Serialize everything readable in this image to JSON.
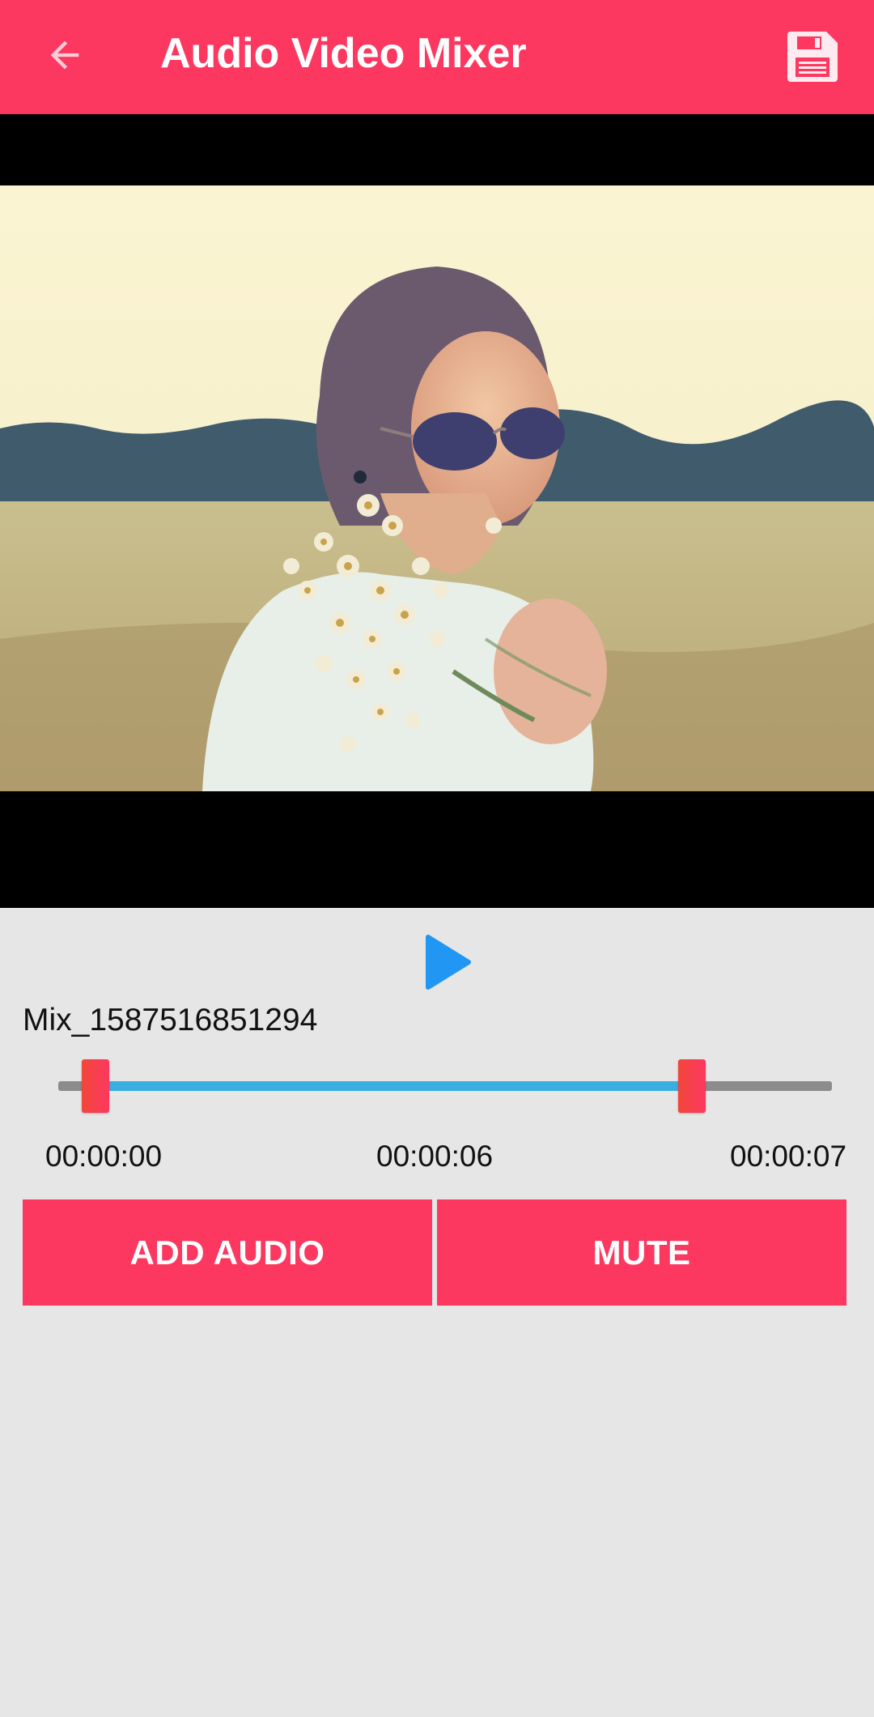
{
  "appbar": {
    "title": "Audio Video Mixer",
    "back_icon": "arrow-back-icon",
    "save_icon": "save-icon",
    "background": "#fd3860"
  },
  "player": {
    "play_icon": "play-icon",
    "play_color": "#2196f3"
  },
  "file": {
    "name": "Mix_1587516851294"
  },
  "trim": {
    "start_time": "00:00:00",
    "current_time": "00:00:06",
    "end_time": "00:00:07",
    "selected_color": "#3aaee0",
    "track_color": "#8c8c8c"
  },
  "actions": {
    "add_audio_label": "ADD AUDIO",
    "mute_label": "MUTE"
  }
}
